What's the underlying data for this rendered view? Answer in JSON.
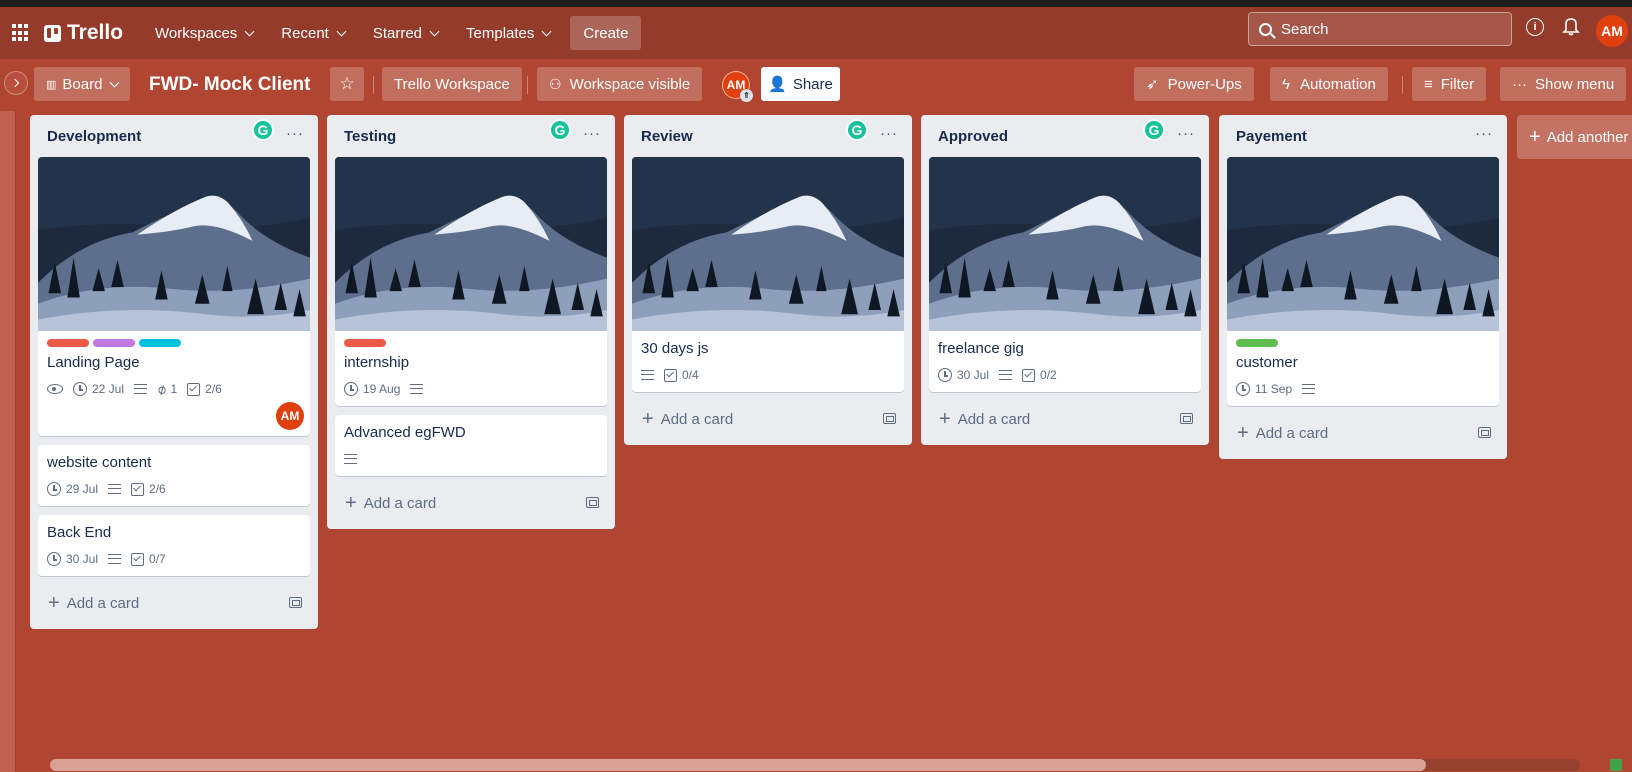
{
  "header": {
    "logo": "Trello",
    "nav": [
      "Workspaces",
      "Recent",
      "Starred",
      "Templates"
    ],
    "create": "Create",
    "search_placeholder": "Search",
    "avatar": "AM"
  },
  "board": {
    "view": "Board",
    "title": "FWD- Mock Client",
    "workspace": "Trello Workspace",
    "visibility": "Workspace visible",
    "member": "AM",
    "share": "Share",
    "powerups": "Power-Ups",
    "automation": "Automation",
    "filter": "Filter",
    "show_menu": "Show menu",
    "add_list": "Add another list"
  },
  "colors": {
    "board_bg": "#b04632",
    "label_red": "#eb5a46",
    "label_purple": "#c377e0",
    "label_sky": "#00c2e0",
    "label_green": "#61bd4f"
  },
  "add_card": "Add a card",
  "lists": [
    {
      "title": "Development",
      "cards": [
        {
          "title": "Landing Page",
          "date": "22 Jul",
          "attachments": "1",
          "checklist": "2/6",
          "member": "AM"
        },
        {
          "title": "website content",
          "date": "29 Jul",
          "checklist": "2/6"
        },
        {
          "title": "Back End",
          "date": "30 Jul",
          "checklist": "0/7"
        }
      ]
    },
    {
      "title": "Testing",
      "cards": [
        {
          "title": "internship",
          "date": "19 Aug"
        },
        {
          "title": "Advanced egFWD"
        }
      ]
    },
    {
      "title": "Review",
      "cards": [
        {
          "title": "30 days js",
          "checklist": "0/4"
        }
      ]
    },
    {
      "title": "Approved",
      "cards": [
        {
          "title": "freelance gig",
          "date": "30 Jul",
          "checklist": "0/2"
        }
      ]
    },
    {
      "title": "Payement",
      "cards": [
        {
          "title": "customer",
          "date": "11 Sep"
        }
      ]
    }
  ]
}
